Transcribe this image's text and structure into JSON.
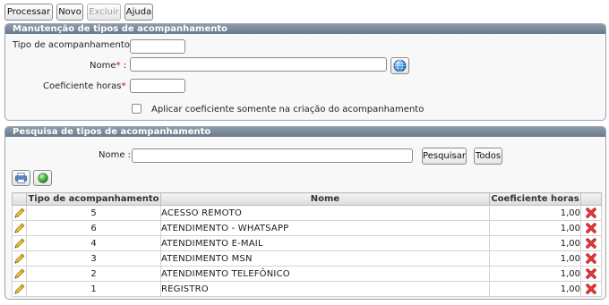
{
  "toolbar": {
    "processar": "Processar",
    "novo": "Novo",
    "excluir": "Excluir",
    "ajuda": "Ajuda"
  },
  "manutencao": {
    "title": "Manutenção de tipos de acompanhamento",
    "tipo_label": "Tipo de acompanhamento :",
    "tipo_value": "",
    "nome_label": "Nome",
    "nome_value": "",
    "coef_label": "Coeficiente horas",
    "coef_value": "",
    "required_mark": "*",
    "sep": ":",
    "checkbox_label": "Aplicar coeficiente somente na criação do acompanhamento",
    "checkbox_checked": false
  },
  "pesquisa": {
    "title": "Pesquisa de tipos de acompanhamento",
    "nome_label": "Nome :",
    "nome_value": "",
    "pesquisar": "Pesquisar",
    "todos": "Todos"
  },
  "grid": {
    "columns": [
      "",
      "Tipo de acompanhamento",
      "Nome",
      "Coeficiente horas",
      ""
    ],
    "rows": [
      {
        "tipo": "5",
        "nome": "ACESSO REMOTO",
        "coef": "1,00"
      },
      {
        "tipo": "6",
        "nome": "ATENDIMENTO - WHATSAPP",
        "coef": "1,00"
      },
      {
        "tipo": "4",
        "nome": "ATENDIMENTO E-MAIL",
        "coef": "1,00"
      },
      {
        "tipo": "3",
        "nome": "ATENDIMENTO MSN",
        "coef": "1,00"
      },
      {
        "tipo": "2",
        "nome": "ATENDIMENTO TELEFÔNICO",
        "coef": "1,00"
      },
      {
        "tipo": "1",
        "nome": "REGISTRO",
        "coef": "1,00"
      }
    ]
  },
  "icons": {
    "edit": "pencil-icon",
    "delete": "delete-x-icon",
    "lookup": "globe-icon",
    "print": "print-icon",
    "status": "green-circle-icon"
  },
  "colors": {
    "panel_header": "#7a8a9c",
    "required": "#d00000",
    "delete": "#d42020"
  }
}
